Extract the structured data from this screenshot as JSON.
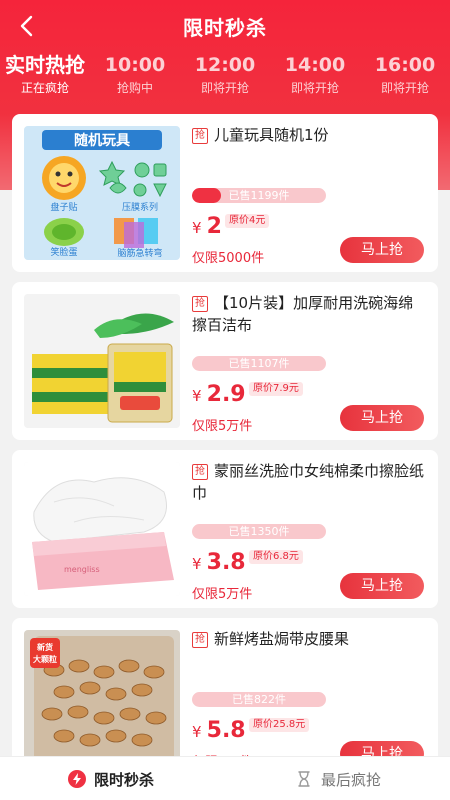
{
  "header": {
    "title": "限时秒杀"
  },
  "slots": [
    {
      "time": "实时热抢",
      "status": "正在疯抢"
    },
    {
      "time": "10:00",
      "status": "抢购中"
    },
    {
      "time": "12:00",
      "status": "即将开抢"
    },
    {
      "time": "14:00",
      "status": "即将开抢"
    },
    {
      "time": "16:00",
      "status": "即将开抢"
    }
  ],
  "products": [
    {
      "badge": "抢",
      "name": "儿童玩具随机1份",
      "sold": "已售1199件",
      "sold_progress": 0.22,
      "currency": "¥",
      "price": "2",
      "original": "原价4元",
      "limit": "仅限5000件",
      "buy": "马上抢",
      "image_texts": {
        "banner": "随机玩具",
        "l1": "盘子贴",
        "l2": "压膜系列",
        "l3": "笑脸蛋",
        "l4": "脑筋急转弯"
      }
    },
    {
      "badge": "抢",
      "name": "【10片装】加厚耐用洗碗海绵擦百洁布",
      "sold": "已售1107件",
      "sold_progress": 0,
      "currency": "¥",
      "price": "2.9",
      "original": "原价7.9元",
      "limit": "仅限5万件",
      "buy": "马上抢"
    },
    {
      "badge": "抢",
      "name": "蒙丽丝洗脸巾女纯棉柔巾擦脸纸巾",
      "sold": "已售1350件",
      "sold_progress": 0,
      "currency": "¥",
      "price": "3.8",
      "original": "原价6.8元",
      "limit": "仅限5万件",
      "buy": "马上抢",
      "image_texts": {
        "brand": "mengliss"
      }
    },
    {
      "badge": "抢",
      "name": "新鲜烤盐焗带皮腰果",
      "sold": "已售822件",
      "sold_progress": 0,
      "currency": "¥",
      "price": "5.8",
      "original": "原价25.8元",
      "limit": "仅限5万件",
      "buy": "马上抢",
      "image_texts": {
        "tag1": "新货",
        "tag2": "大颗粒"
      }
    }
  ],
  "tabs": [
    {
      "label": "限时秒杀",
      "icon": "lightning-icon"
    },
    {
      "label": "最后疯抢",
      "icon": "hourglass-icon"
    }
  ],
  "colors": {
    "accent": "#f1313f",
    "price": "#e8283a"
  }
}
